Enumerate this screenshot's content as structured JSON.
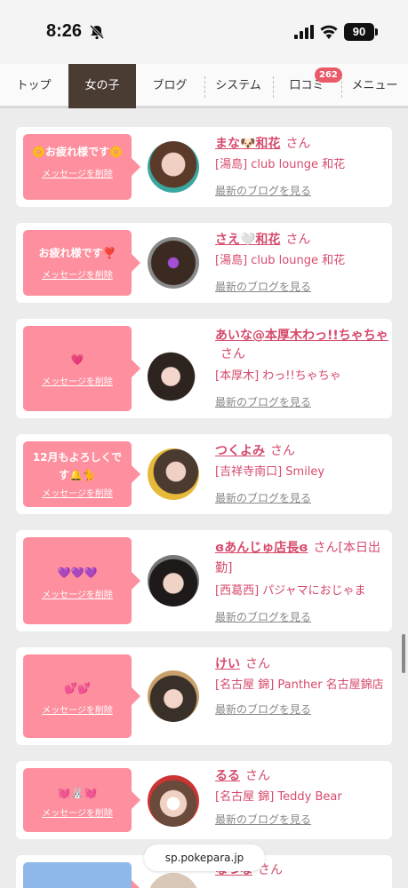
{
  "status_bar": {
    "time": "8:26",
    "battery": "90"
  },
  "tabs": [
    {
      "label": "トップ"
    },
    {
      "label": "女の子"
    },
    {
      "label": "ブログ"
    },
    {
      "label": "システム"
    },
    {
      "label": "口コミ",
      "badge": "262"
    },
    {
      "label": "メニュー"
    }
  ],
  "delete_label": "メッセージを削除",
  "san_label": "さん",
  "blog_link_label": "最新のブログを見る",
  "cards": [
    {
      "message": "🌼お疲れ様です🌼",
      "name": "まな🐶和花",
      "san": "さん",
      "shop": "[湯島] club lounge 和花"
    },
    {
      "message": "お疲れ様です❣️",
      "name": "さえ🤍和花",
      "san": "さん",
      "shop": "[湯島] club lounge 和花"
    },
    {
      "message": "💗",
      "name": "あいな@本厚木わっ!!ちゃちゃ",
      "san": "さん",
      "shop": "[本厚木] わっ!!ちゃちゃ"
    },
    {
      "message": "12月もよろしくです🔔🐈",
      "name": "つくよみ",
      "san": "さん",
      "shop": "[吉祥寺南口] Smiley"
    },
    {
      "message": "💜💜💜",
      "name": "ɞあんじゅ店長ɞ",
      "san": "さん[本日出勤]",
      "shop": "[西葛西] パジャマにおじゃま"
    },
    {
      "message": "💕💕",
      "name": "けい",
      "san": "さん",
      "shop": "[名古屋 錦] Panther 名古屋錦店"
    },
    {
      "message": "💓🐰💓",
      "name": "るる",
      "san": "さん",
      "shop": "[名古屋 錦] Teddy Bear"
    },
    {
      "message": "",
      "name": "なつな",
      "san": "さん",
      "shop": ""
    }
  ],
  "url": "sp.pokepara.jp",
  "colors": {
    "accent": "#d64a6b",
    "bubble": "#fd8f9e",
    "active_tab": "#4a3b33",
    "badge": "#e85a6a"
  }
}
